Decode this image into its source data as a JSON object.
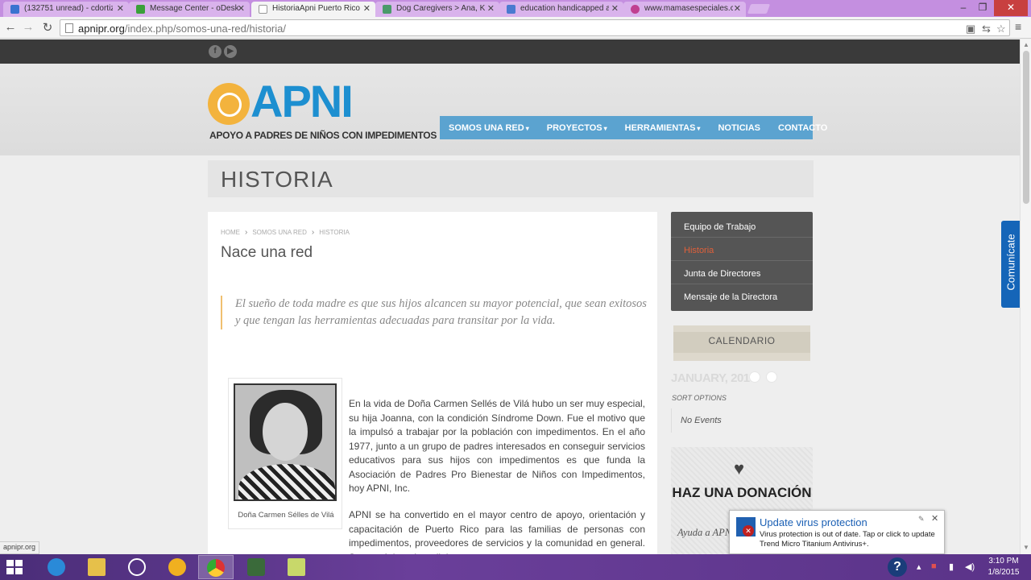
{
  "browser": {
    "tabs": [
      {
        "label": "(132751 unread) - cdortiz",
        "icon_color": "#3a73d0",
        "active": false
      },
      {
        "label": "Message Center - oDesk",
        "icon_color": "#3aa03a",
        "active": false
      },
      {
        "label": "HistoriaApni Puerto Rico",
        "icon_color": "#ffffff",
        "active": true
      },
      {
        "label": "Dog Caregivers > Ana, Ka",
        "icon_color": "#4a9a6a",
        "active": false
      },
      {
        "label": "education handicapped a",
        "icon_color": "#4a7ad0",
        "active": false
      },
      {
        "label": "www.mamasespeciales.co",
        "icon_color": "#c04090",
        "active": false
      }
    ],
    "url_host": "apnipr.org",
    "url_path": "/index.php/somos-una-red/historia/",
    "status_url": "apnipr.org"
  },
  "site": {
    "logo_text": "APNI",
    "logo_subtitle": "APOYO A PADRES DE NIÑOS CON IMPEDIMENTOS",
    "nav": [
      {
        "label": "SOMOS UNA RED",
        "has_caret": true
      },
      {
        "label": "PROYECTOS",
        "has_caret": true
      },
      {
        "label": "HERRAMIENTAS",
        "has_caret": true
      },
      {
        "label": "NOTICIAS",
        "has_caret": false
      },
      {
        "label": "CONTACTO",
        "has_caret": false
      }
    ],
    "accent_color": "#5ba3d0"
  },
  "page": {
    "title": "HISTORIA",
    "breadcrumb": [
      "HOME",
      "SOMOS UNA RED",
      "HISTORIA"
    ],
    "subtitle": "Nace una red",
    "quote": "El sueño de toda madre es que sus hijos alcancen su mayor potencial, que sean exitosos y que tengan las herramientas adecuadas para transitar por la vida.",
    "photo_caption": "Doña Carmen Sélles de Vilá",
    "paragraph1": "En la vida de Doña Carmen Sellés de Vilá hubo un ser muy especial, su hija Joanna, con la condición Síndrome Down. Fue el motivo que la impulsó a trabajar por la población con impedimentos. En el año 1977, junto a un grupo de padres interesados en conseguir servicios educativos para sus hijos con impedimentos es que funda la Asociación de Padres Pro Bienestar de Niños con Impedimentos, hoy APNI, Inc.",
    "paragraph2": "APNI se ha convertido en el mayor centro de apoyo, orientación y capacitación de Puerto Rico para las familias de personas con impedimentos, proveedores de servicios y la comunidad en general. Su propósito primordial es"
  },
  "sidebar": {
    "menu": [
      {
        "label": "Equipo de Trabajo",
        "active": false
      },
      {
        "label": "Historia",
        "active": true
      },
      {
        "label": "Junta de Directores",
        "active": false
      },
      {
        "label": "Mensaje de la Directora",
        "active": false
      }
    ],
    "calendar_title": "CALENDARIO",
    "calendar_month": "JANUARY, 2015",
    "sort_options": "SORT OPTIONS",
    "no_events": "No Events",
    "donate_title": "HAZ UNA DONACIÓN",
    "donate_text": "Ayuda a APNI dando ap"
  },
  "comunicate_label": "Comunícate",
  "notification": {
    "title": "Update virus protection",
    "body": "Virus protection is out of date. Tap or click to update Trend Micro Titanium Antivirus+."
  },
  "taskbar": {
    "time": "3:10 PM",
    "date": "1/8/2015"
  }
}
